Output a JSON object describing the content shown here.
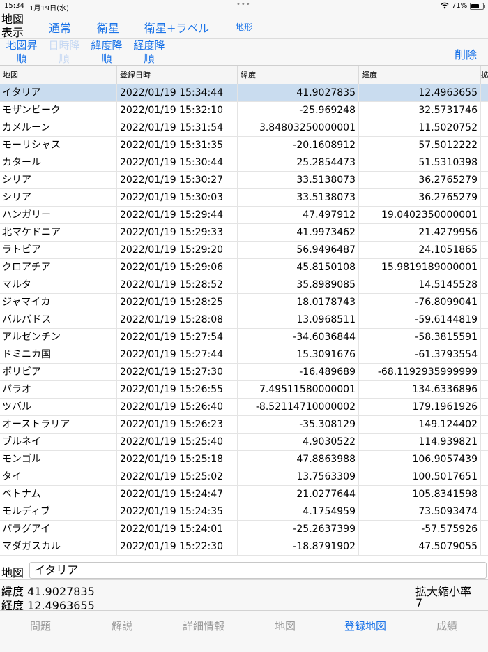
{
  "status": {
    "time": "15:34",
    "date": "1月19日(水)",
    "dots": "•••",
    "battery_pct": "71%",
    "battery_level": 0.71,
    "wifi_icon": "wifi-icon"
  },
  "toolbar": {
    "map_display_label": "地図\n表示",
    "modes": [
      "通常",
      "衛星",
      "衛星+ラベル",
      "地形"
    ],
    "sort_buttons": [
      "地図昇\n順",
      "日時降\n順",
      "緯度降\n順",
      "経度降\n順"
    ],
    "delete_label": "削除"
  },
  "table": {
    "columns": [
      "地図",
      "登録日時",
      "緯度",
      "経度",
      "拡"
    ],
    "rows": [
      {
        "name": "イタリア",
        "date": "2022/01/19 15:34:44",
        "lat": "41.9027835",
        "lng": "12.4963655"
      },
      {
        "name": "モザンビーク",
        "date": "2022/01/19 15:32:10",
        "lat": "-25.969248",
        "lng": "32.5731746"
      },
      {
        "name": "カメルーン",
        "date": "2022/01/19 15:31:54",
        "lat": "3.84803250000001",
        "lng": "11.5020752"
      },
      {
        "name": "モーリシャス",
        "date": "2022/01/19 15:31:35",
        "lat": "-20.1608912",
        "lng": "57.5012222"
      },
      {
        "name": "カタール",
        "date": "2022/01/19 15:30:44",
        "lat": "25.2854473",
        "lng": "51.5310398"
      },
      {
        "name": "シリア",
        "date": "2022/01/19 15:30:27",
        "lat": "33.5138073",
        "lng": "36.2765279"
      },
      {
        "name": "シリア",
        "date": "2022/01/19 15:30:03",
        "lat": "33.5138073",
        "lng": "36.2765279"
      },
      {
        "name": "ハンガリー",
        "date": "2022/01/19 15:29:44",
        "lat": "47.497912",
        "lng": "19.0402350000001"
      },
      {
        "name": "北マケドニア",
        "date": "2022/01/19 15:29:33",
        "lat": "41.9973462",
        "lng": "21.4279956"
      },
      {
        "name": "ラトビア",
        "date": "2022/01/19 15:29:20",
        "lat": "56.9496487",
        "lng": "24.1051865"
      },
      {
        "name": "クロアチア",
        "date": "2022/01/19 15:29:06",
        "lat": "45.8150108",
        "lng": "15.9819189000001"
      },
      {
        "name": "マルタ",
        "date": "2022/01/19 15:28:52",
        "lat": "35.8989085",
        "lng": "14.5145528"
      },
      {
        "name": "ジャマイカ",
        "date": "2022/01/19 15:28:25",
        "lat": "18.0178743",
        "lng": "-76.8099041"
      },
      {
        "name": "バルバドス",
        "date": "2022/01/19 15:28:08",
        "lat": "13.0968511",
        "lng": "-59.6144819"
      },
      {
        "name": "アルゼンチン",
        "date": "2022/01/19 15:27:54",
        "lat": "-34.6036844",
        "lng": "-58.3815591"
      },
      {
        "name": "ドミニカ国",
        "date": "2022/01/19 15:27:44",
        "lat": "15.3091676",
        "lng": "-61.3793554"
      },
      {
        "name": "ボリビア",
        "date": "2022/01/19 15:27:30",
        "lat": "-16.489689",
        "lng": "-68.1192935999999"
      },
      {
        "name": "パラオ",
        "date": "2022/01/19 15:26:55",
        "lat": "7.49511580000001",
        "lng": "134.6336896"
      },
      {
        "name": "ツバル",
        "date": "2022/01/19 15:26:40",
        "lat": "-8.52114710000002",
        "lng": "179.1961926"
      },
      {
        "name": "オーストラリア",
        "date": "2022/01/19 15:26:23",
        "lat": "-35.308129",
        "lng": "149.124402"
      },
      {
        "name": "ブルネイ",
        "date": "2022/01/19 15:25:40",
        "lat": "4.9030522",
        "lng": "114.939821"
      },
      {
        "name": "モンゴル",
        "date": "2022/01/19 15:25:18",
        "lat": "47.8863988",
        "lng": "106.9057439"
      },
      {
        "name": "タイ",
        "date": "2022/01/19 15:25:02",
        "lat": "13.7563309",
        "lng": "100.5017651"
      },
      {
        "name": "ベトナム",
        "date": "2022/01/19 15:24:47",
        "lat": "21.0277644",
        "lng": "105.8341598"
      },
      {
        "name": "モルディブ",
        "date": "2022/01/19 15:24:35",
        "lat": "4.1754959",
        "lng": "73.5093474"
      },
      {
        "name": "パラグアイ",
        "date": "2022/01/19 15:24:01",
        "lat": "-25.2637399",
        "lng": "-57.575926"
      },
      {
        "name": "マダガスカル",
        "date": "2022/01/19 15:22:30",
        "lat": "-18.8791902",
        "lng": "47.5079055"
      }
    ]
  },
  "detail": {
    "map_label": "地図",
    "map_value": "イタリア",
    "lat_label": "緯度",
    "lat_value": "41.9027835",
    "lng_label": "経度",
    "lng_value": "12.4963655",
    "zoom_label": "拡大縮小率",
    "zoom_value": "7"
  },
  "tabs": [
    "問題",
    "解説",
    "詳細情報",
    "地図",
    "登録地図",
    "成績"
  ],
  "colors": {
    "accent": "#1a73e8",
    "selected_row": "#c9dcef"
  }
}
